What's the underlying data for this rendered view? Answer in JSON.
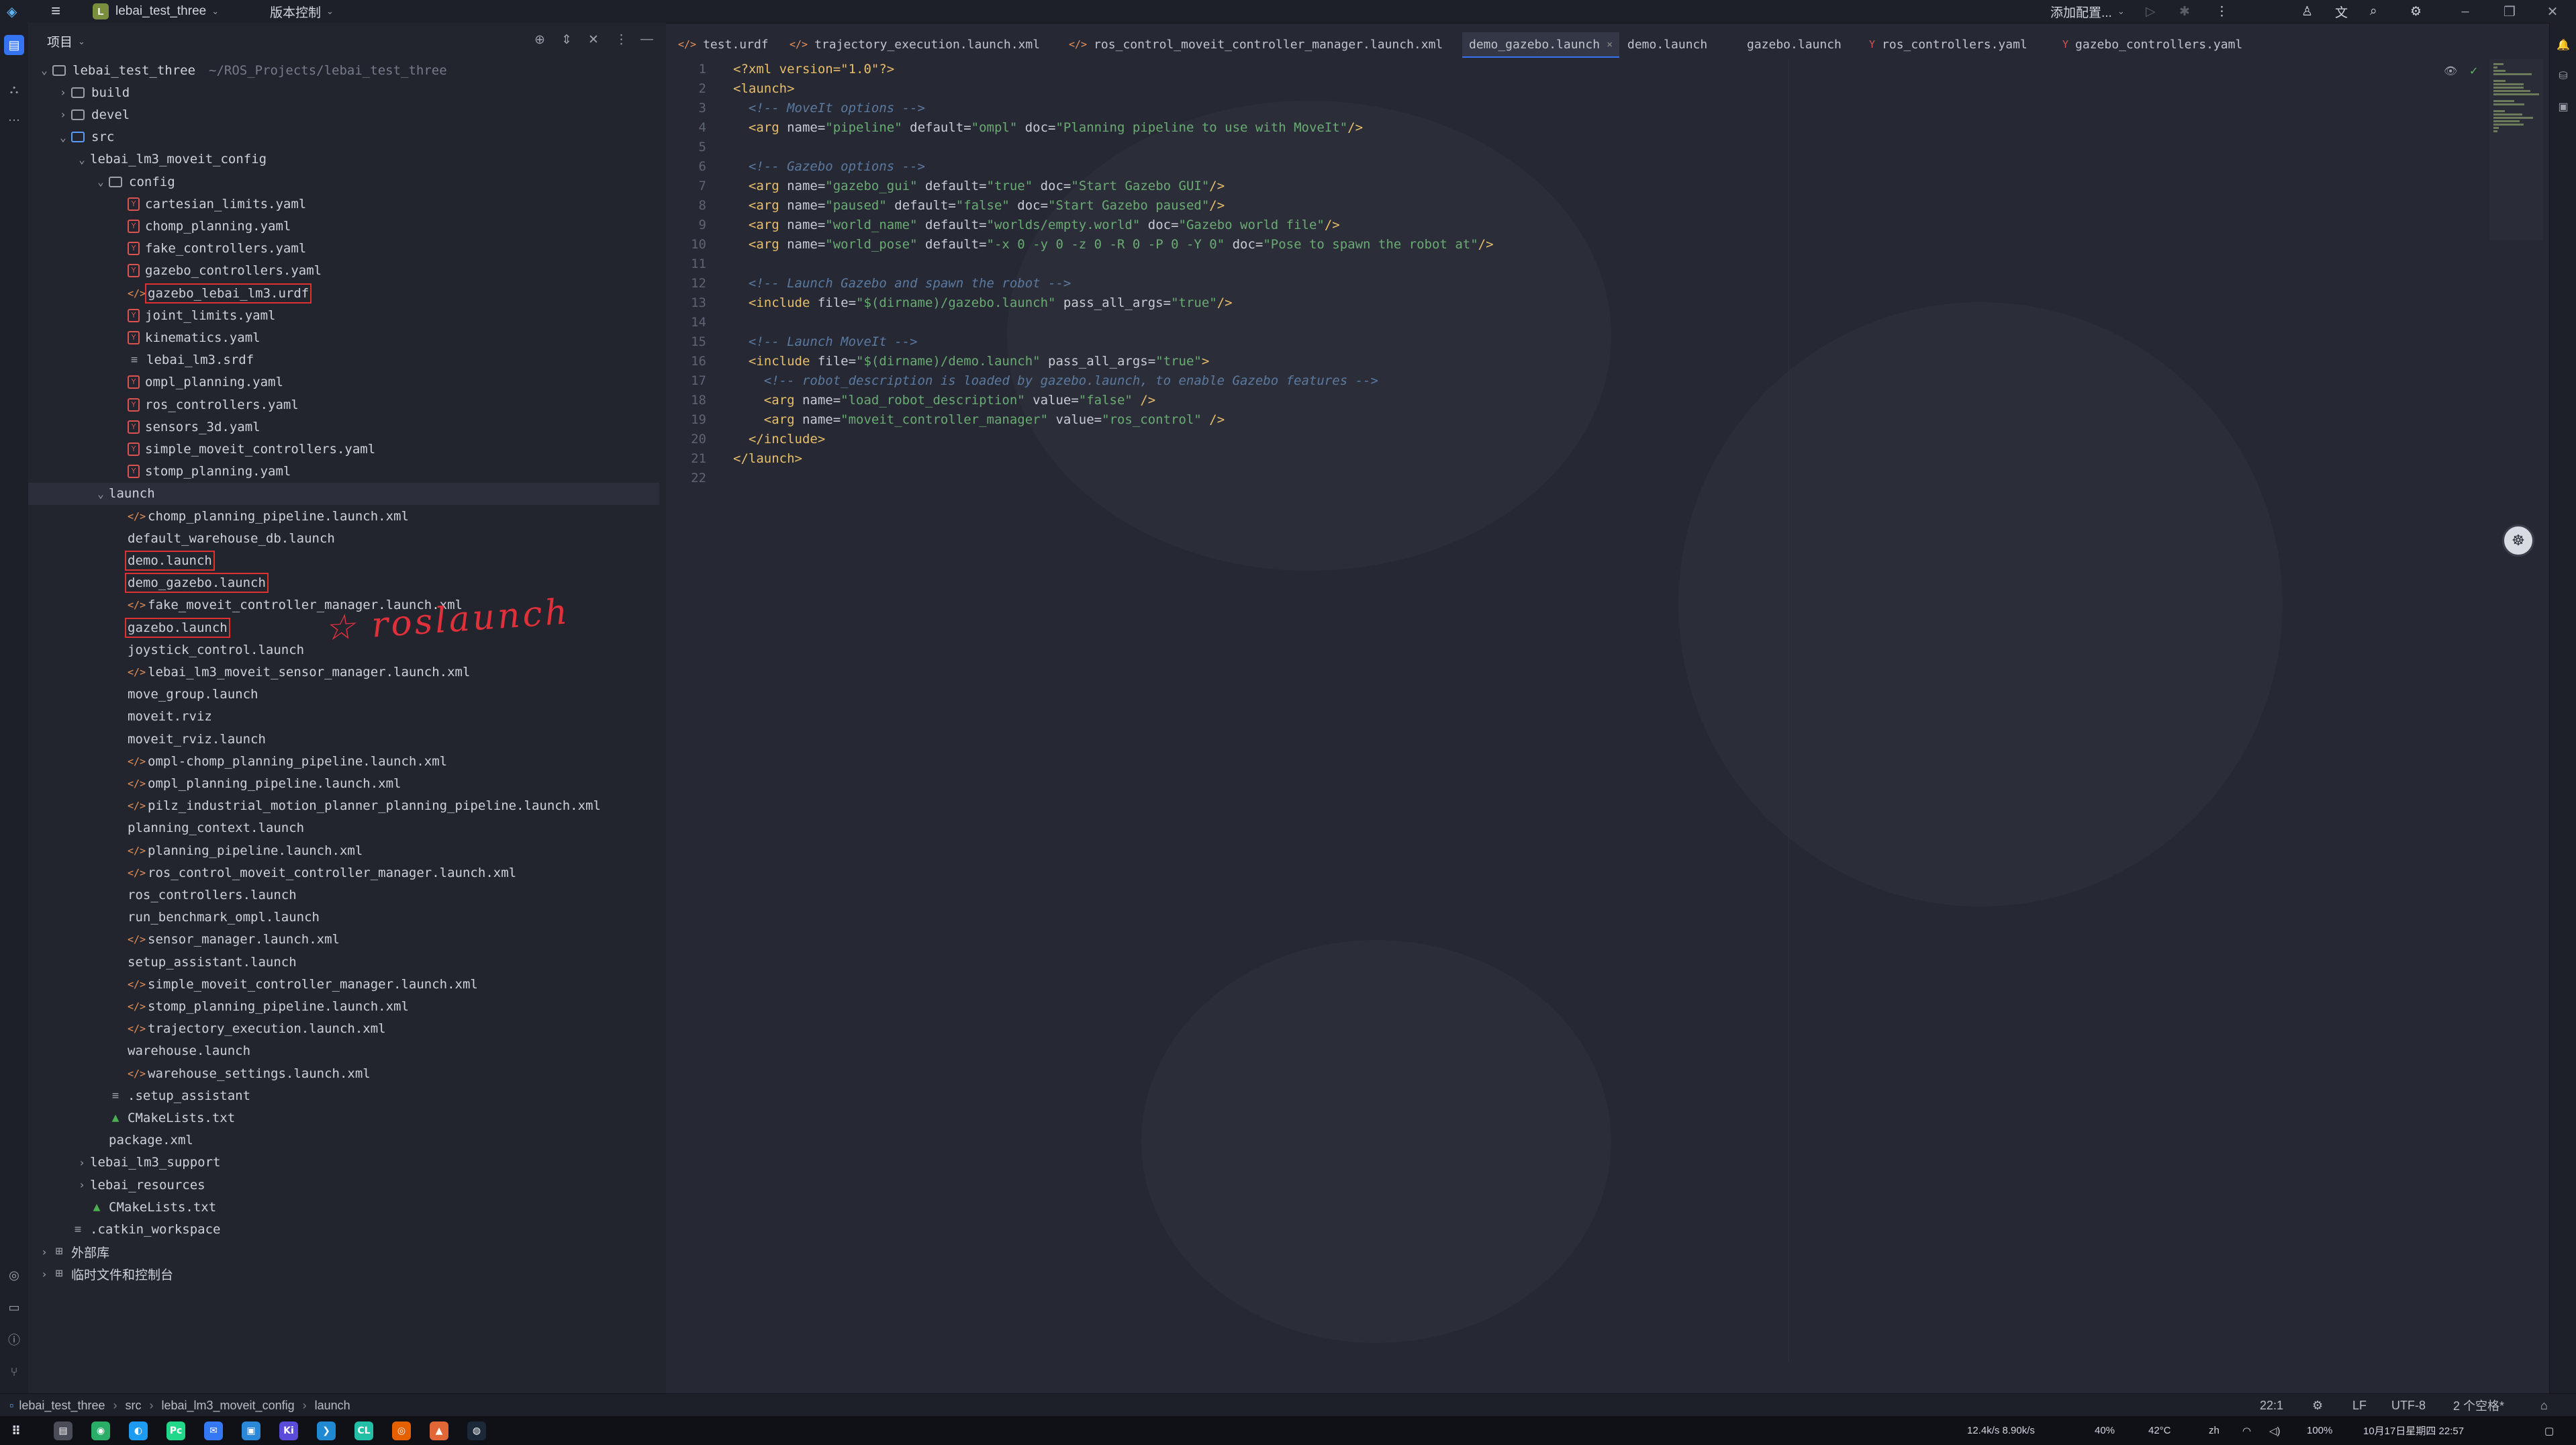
{
  "titlebar": {
    "project_badge": "L",
    "project_name": "lebai_test_three",
    "vcs_menu": "版本控制",
    "run_config": "添加配置...",
    "icons": [
      "main-menu-icon",
      "run-icon",
      "debug-icon",
      "more-icon",
      "account-icon",
      "translate-icon",
      "search-icon",
      "settings-icon",
      "minimize-icon",
      "restore-icon",
      "close-icon"
    ]
  },
  "project_panel": {
    "title": "项目",
    "rows": [
      {
        "depth": 0,
        "arrow": "v",
        "icon": "folder",
        "label": "lebai_test_three",
        "hint": "~/ROS_Projects/lebai_test_three"
      },
      {
        "depth": 1,
        "arrow": ">",
        "icon": "folder",
        "label": "build"
      },
      {
        "depth": 1,
        "arrow": ">",
        "icon": "folder",
        "label": "devel"
      },
      {
        "depth": 1,
        "arrow": "v",
        "icon": "src",
        "label": "src"
      },
      {
        "depth": 2,
        "arrow": "v",
        "icon": "none",
        "label": "lebai_lm3_moveit_config"
      },
      {
        "depth": 3,
        "arrow": "v",
        "icon": "folder",
        "label": "config"
      },
      {
        "depth": 4,
        "icon": "yaml",
        "label": "cartesian_limits.yaml"
      },
      {
        "depth": 4,
        "icon": "yaml",
        "label": "chomp_planning.yaml"
      },
      {
        "depth": 4,
        "icon": "yaml",
        "label": "fake_controllers.yaml"
      },
      {
        "depth": 4,
        "icon": "yaml",
        "label": "gazebo_controllers.yaml"
      },
      {
        "depth": 4,
        "icon": "xml",
        "label": "gazebo_lebai_lm3.urdf",
        "boxed": true
      },
      {
        "depth": 4,
        "icon": "yaml",
        "label": "joint_limits.yaml"
      },
      {
        "depth": 4,
        "icon": "yaml",
        "label": "kinematics.yaml"
      },
      {
        "depth": 4,
        "icon": "txt",
        "label": "lebai_lm3.srdf"
      },
      {
        "depth": 4,
        "icon": "yaml",
        "label": "ompl_planning.yaml"
      },
      {
        "depth": 4,
        "icon": "yaml",
        "label": "ros_controllers.yaml"
      },
      {
        "depth": 4,
        "icon": "yaml",
        "label": "sensors_3d.yaml"
      },
      {
        "depth": 4,
        "icon": "yaml",
        "label": "simple_moveit_controllers.yaml"
      },
      {
        "depth": 4,
        "icon": "yaml",
        "label": "stomp_planning.yaml"
      },
      {
        "depth": 3,
        "arrow": "v",
        "icon": "none",
        "label": "launch",
        "selected": true
      },
      {
        "depth": 4,
        "icon": "xml",
        "label": "chomp_planning_pipeline.launch.xml"
      },
      {
        "depth": 4,
        "icon": "none",
        "label": "default_warehouse_db.launch"
      },
      {
        "depth": 4,
        "icon": "none",
        "label": "demo.launch",
        "boxed": true
      },
      {
        "depth": 4,
        "icon": "none",
        "label": "demo_gazebo.launch",
        "boxed": true
      },
      {
        "depth": 4,
        "icon": "xml",
        "label": "fake_moveit_controller_manager.launch.xml"
      },
      {
        "depth": 4,
        "icon": "none",
        "label": "gazebo.launch",
        "boxed": true
      },
      {
        "depth": 4,
        "icon": "none",
        "label": "joystick_control.launch"
      },
      {
        "depth": 4,
        "icon": "xml",
        "label": "lebai_lm3_moveit_sensor_manager.launch.xml"
      },
      {
        "depth": 4,
        "icon": "none",
        "label": "move_group.launch"
      },
      {
        "depth": 4,
        "icon": "none",
        "label": "moveit.rviz"
      },
      {
        "depth": 4,
        "icon": "none",
        "label": "moveit_rviz.launch"
      },
      {
        "depth": 4,
        "icon": "xml",
        "label": "ompl-chomp_planning_pipeline.launch.xml"
      },
      {
        "depth": 4,
        "icon": "xml",
        "label": "ompl_planning_pipeline.launch.xml"
      },
      {
        "depth": 4,
        "icon": "xml",
        "label": "pilz_industrial_motion_planner_planning_pipeline.launch.xml"
      },
      {
        "depth": 4,
        "icon": "none",
        "label": "planning_context.launch"
      },
      {
        "depth": 4,
        "icon": "xml",
        "label": "planning_pipeline.launch.xml"
      },
      {
        "depth": 4,
        "icon": "xml",
        "label": "ros_control_moveit_controller_manager.launch.xml"
      },
      {
        "depth": 4,
        "icon": "none",
        "label": "ros_controllers.launch"
      },
      {
        "depth": 4,
        "icon": "none",
        "label": "run_benchmark_ompl.launch"
      },
      {
        "depth": 4,
        "icon": "xml",
        "label": "sensor_manager.launch.xml"
      },
      {
        "depth": 4,
        "icon": "none",
        "label": "setup_assistant.launch"
      },
      {
        "depth": 4,
        "icon": "xml",
        "label": "simple_moveit_controller_manager.launch.xml"
      },
      {
        "depth": 4,
        "icon": "xml",
        "label": "stomp_planning_pipeline.launch.xml"
      },
      {
        "depth": 4,
        "icon": "xml",
        "label": "trajectory_execution.launch.xml"
      },
      {
        "depth": 4,
        "icon": "none",
        "label": "warehouse.launch"
      },
      {
        "depth": 4,
        "icon": "xml",
        "label": "warehouse_settings.launch.xml"
      },
      {
        "depth": 3,
        "icon": "txt",
        "label": ".setup_assistant"
      },
      {
        "depth": 3,
        "icon": "cmake",
        "label": "CMakeLists.txt"
      },
      {
        "depth": 3,
        "icon": "none",
        "label": "package.xml"
      },
      {
        "depth": 2,
        "arrow": ">",
        "icon": "none",
        "label": "lebai_lm3_support"
      },
      {
        "depth": 2,
        "arrow": ">",
        "icon": "none",
        "label": "lebai_resources"
      },
      {
        "depth": 2,
        "icon": "cmake",
        "label": "CMakeLists.txt"
      },
      {
        "depth": 1,
        "icon": "txt",
        "label": ".catkin_workspace"
      },
      {
        "depth": 0,
        "arrow": ">",
        "icon": "lib",
        "label": "外部库"
      },
      {
        "depth": 0,
        "arrow": ">",
        "icon": "lib",
        "label": "临时文件和控制台"
      }
    ]
  },
  "annotation": {
    "text": "roslaunch",
    "mark": "☆"
  },
  "tabs": [
    {
      "label": "test.urdf",
      "icon": "xml"
    },
    {
      "label": "trajectory_execution.launch.xml",
      "icon": "xml"
    },
    {
      "label": "ros_control_moveit_controller_manager.launch.xml",
      "icon": "xml"
    },
    {
      "label": "demo_gazebo.launch",
      "icon": "none",
      "active": true
    },
    {
      "label": "demo.launch",
      "icon": "none"
    },
    {
      "label": "gazebo.launch",
      "icon": "none"
    },
    {
      "label": "ros_controllers.yaml",
      "icon": "yaml"
    },
    {
      "label": "gazebo_controllers.yaml",
      "icon": "yaml"
    }
  ],
  "editor": {
    "lines": [
      [
        {
          "t": "decl",
          "s": "<?xml version=\"1.0\"?>"
        }
      ],
      [
        {
          "t": "tag",
          "s": "<launch>"
        }
      ],
      [
        {
          "t": "sp",
          "s": "  "
        },
        {
          "t": "comment",
          "s": "<!-- MoveIt options -->"
        }
      ],
      [
        {
          "t": "sp",
          "s": "  "
        },
        {
          "t": "tag",
          "s": "<arg "
        },
        {
          "t": "attr",
          "s": "name="
        },
        {
          "t": "val",
          "s": "\"pipeline\""
        },
        {
          "t": "attr",
          "s": " default="
        },
        {
          "t": "val",
          "s": "\"ompl\""
        },
        {
          "t": "attr",
          "s": " doc="
        },
        {
          "t": "val",
          "s": "\"Planning pipeline to use with MoveIt\""
        },
        {
          "t": "tag",
          "s": "/>"
        }
      ],
      [],
      [
        {
          "t": "sp",
          "s": "  "
        },
        {
          "t": "comment",
          "s": "<!-- Gazebo options -->"
        }
      ],
      [
        {
          "t": "sp",
          "s": "  "
        },
        {
          "t": "tag",
          "s": "<arg "
        },
        {
          "t": "attr",
          "s": "name="
        },
        {
          "t": "val",
          "s": "\"gazebo_gui\""
        },
        {
          "t": "attr",
          "s": " default="
        },
        {
          "t": "val",
          "s": "\"true\""
        },
        {
          "t": "attr",
          "s": " doc="
        },
        {
          "t": "val",
          "s": "\"Start Gazebo GUI\""
        },
        {
          "t": "tag",
          "s": "/>"
        }
      ],
      [
        {
          "t": "sp",
          "s": "  "
        },
        {
          "t": "tag",
          "s": "<arg "
        },
        {
          "t": "attr",
          "s": "name="
        },
        {
          "t": "val",
          "s": "\"paused\""
        },
        {
          "t": "attr",
          "s": " default="
        },
        {
          "t": "val",
          "s": "\"false\""
        },
        {
          "t": "attr",
          "s": " doc="
        },
        {
          "t": "val",
          "s": "\"Start Gazebo paused\""
        },
        {
          "t": "tag",
          "s": "/>"
        }
      ],
      [
        {
          "t": "sp",
          "s": "  "
        },
        {
          "t": "tag",
          "s": "<arg "
        },
        {
          "t": "attr",
          "s": "name="
        },
        {
          "t": "val",
          "s": "\"world_name\""
        },
        {
          "t": "attr",
          "s": " default="
        },
        {
          "t": "val",
          "s": "\"worlds/empty.world\""
        },
        {
          "t": "attr",
          "s": " doc="
        },
        {
          "t": "val",
          "s": "\"Gazebo world file\""
        },
        {
          "t": "tag",
          "s": "/>"
        }
      ],
      [
        {
          "t": "sp",
          "s": "  "
        },
        {
          "t": "tag",
          "s": "<arg "
        },
        {
          "t": "attr",
          "s": "name="
        },
        {
          "t": "val",
          "s": "\"world_pose\""
        },
        {
          "t": "attr",
          "s": " default="
        },
        {
          "t": "val",
          "s": "\"-x 0 -y 0 -z 0 -R 0 -P 0 -Y 0\""
        },
        {
          "t": "attr",
          "s": " doc="
        },
        {
          "t": "val",
          "s": "\"Pose to spawn the robot at\""
        },
        {
          "t": "tag",
          "s": "/>"
        }
      ],
      [],
      [
        {
          "t": "sp",
          "s": "  "
        },
        {
          "t": "comment",
          "s": "<!-- Launch Gazebo and spawn the robot -->"
        }
      ],
      [
        {
          "t": "sp",
          "s": "  "
        },
        {
          "t": "tag",
          "s": "<include "
        },
        {
          "t": "attr",
          "s": "file="
        },
        {
          "t": "val",
          "s": "\"$(dirname)/gazebo.launch\""
        },
        {
          "t": "attr",
          "s": " pass_all_args="
        },
        {
          "t": "val",
          "s": "\"true\""
        },
        {
          "t": "tag",
          "s": "/>"
        }
      ],
      [],
      [
        {
          "t": "sp",
          "s": "  "
        },
        {
          "t": "comment",
          "s": "<!-- Launch MoveIt -->"
        }
      ],
      [
        {
          "t": "sp",
          "s": "  "
        },
        {
          "t": "tag",
          "s": "<include "
        },
        {
          "t": "attr",
          "s": "file="
        },
        {
          "t": "val",
          "s": "\"$(dirname)/demo.launch\""
        },
        {
          "t": "attr",
          "s": " pass_all_args="
        },
        {
          "t": "val",
          "s": "\"true\""
        },
        {
          "t": "tag",
          "s": ">"
        }
      ],
      [
        {
          "t": "sp",
          "s": "    "
        },
        {
          "t": "comment",
          "s": "<!-- robot_description is loaded by gazebo.launch, to enable Gazebo features -->"
        }
      ],
      [
        {
          "t": "sp",
          "s": "    "
        },
        {
          "t": "tag",
          "s": "<arg "
        },
        {
          "t": "attr",
          "s": "name="
        },
        {
          "t": "val",
          "s": "\"load_robot_description\""
        },
        {
          "t": "attr",
          "s": " value="
        },
        {
          "t": "val",
          "s": "\"false\""
        },
        {
          "t": "tag",
          "s": " />"
        }
      ],
      [
        {
          "t": "sp",
          "s": "    "
        },
        {
          "t": "tag",
          "s": "<arg "
        },
        {
          "t": "attr",
          "s": "name="
        },
        {
          "t": "val",
          "s": "\"moveit_controller_manager\""
        },
        {
          "t": "attr",
          "s": " value="
        },
        {
          "t": "val",
          "s": "\"ros_control\""
        },
        {
          "t": "tag",
          "s": " />"
        }
      ],
      [
        {
          "t": "sp",
          "s": "  "
        },
        {
          "t": "tag",
          "s": "</include>"
        }
      ],
      [
        {
          "t": "tag",
          "s": "</launch>"
        }
      ],
      []
    ]
  },
  "statusbar": {
    "breadcrumb": [
      "lebai_test_three",
      "src",
      "lebai_lm3_moveit_config",
      "launch"
    ],
    "position": "22:1",
    "line_sep": "LF",
    "encoding": "UTF-8",
    "indent": "2 个空格*"
  },
  "taskbar": {
    "apps": [
      {
        "name": "files",
        "color": "#4a4d58",
        "glyph": "▤"
      },
      {
        "name": "wechat",
        "color": "#2aae67",
        "glyph": "◉"
      },
      {
        "name": "qq",
        "color": "#1d9bf0",
        "glyph": "◐"
      },
      {
        "name": "pycharm",
        "color": "#21d789",
        "glyph": "Pc"
      },
      {
        "name": "mail",
        "color": "#3478f6",
        "glyph": "✉"
      },
      {
        "name": "ms",
        "color": "#2b88d8",
        "glyph": "▣"
      },
      {
        "name": "ki",
        "color": "#5b4bdb",
        "glyph": "Ki"
      },
      {
        "name": "vscode",
        "color": "#1f8ad2",
        "glyph": "❯"
      },
      {
        "name": "clion",
        "color": "#21c0a6",
        "glyph": "CL"
      },
      {
        "name": "firefox",
        "color": "#e66000",
        "glyph": "◎"
      },
      {
        "name": "matlab",
        "color": "#e16737",
        "glyph": "▲"
      },
      {
        "name": "steam",
        "color": "#1b2838",
        "glyph": "◍"
      }
    ],
    "tray": {
      "net": "12.4k/s  8.90k/s",
      "cpu": "40%",
      "temp": "42°C",
      "ime": "zh",
      "battery": "100%",
      "clock": "10月17日星期四 22:57"
    }
  }
}
